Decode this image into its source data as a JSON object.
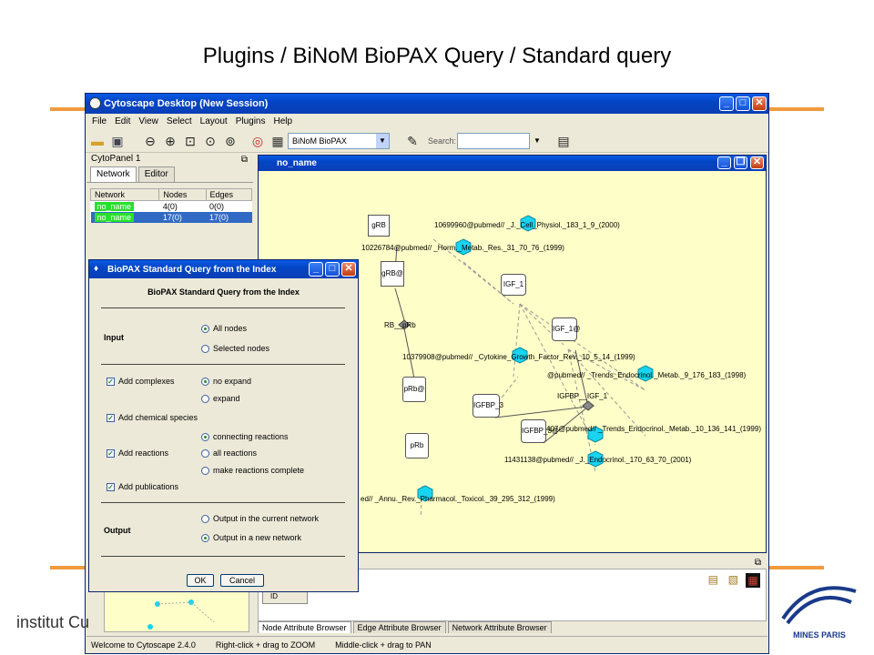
{
  "slide_title": "Plugins / BiNoM BioPAX Query / Standard query",
  "window": {
    "title": "Cytoscape Desktop (New Session)",
    "menu": [
      "File",
      "Edit",
      "View",
      "Select",
      "Layout",
      "Plugins",
      "Help"
    ],
    "plugin_select": "BiNoM BioPAX",
    "search_label": "Search:"
  },
  "cytopanel": {
    "title": "CytoPanel 1",
    "tabs": [
      "Network",
      "Editor"
    ],
    "table": {
      "headers": [
        "Network",
        "Nodes",
        "Edges"
      ],
      "rows": [
        {
          "name": "no_name",
          "nodes": "4(0)",
          "edges": "0(0)"
        },
        {
          "name": "no_name",
          "nodes": "17(0)",
          "edges": "17(0)"
        }
      ]
    }
  },
  "network_view": {
    "title": "no_name",
    "labels": {
      "n1": "10699960@pubmed// _J._Cell_Physiol._183_1_9_(2000)",
      "n2": "10226784@pubmed// _Horm._Metab._Res._31_70_76_(1999)",
      "n3": "10379908@pubmed// _Cytokine_Growth_Factor_Rev._10_5_14_(1999)",
      "n4": "@pubmed// _Trends_Endocrinol._Metab._9_176_183_(1998)",
      "n5": "407@pubmed// _Trends_Endocrinol._Metab._10_136_141_(1999)",
      "n6": "11431138@pubmed// _J._Endocrinol._170_63_70_(2001)",
      "n7": "ed// _Annu._Rev._Pharmacol._Toxicol._39_295_312_(1999)",
      "grb": "gRB",
      "grb_at": "gRB@",
      "rb_prb": "RB__pRb",
      "prb_at": "pRb@",
      "prb": "pRb",
      "igf1": "IGF_1",
      "igf1_at": "IGF_1@",
      "igfbp3": "IGFBP_3",
      "igfbp3_at": "IGFBP_3@",
      "igfbp_igf1": "IGFBP__IGF_1"
    }
  },
  "dialog": {
    "title": "BioPAX Standard Query from the Index",
    "heading": "BioPAX Standard Query from the Index",
    "input_label": "Input",
    "all_nodes": "All nodes",
    "selected_nodes": "Selected nodes",
    "add_complexes": "Add complexes",
    "no_expand": "no expand",
    "expand": "expand",
    "add_chemical": "Add chemical species",
    "connecting_reactions": "connecting reactions",
    "add_reactions": "Add reactions",
    "all_reactions": "all reactions",
    "make_complete": "make reactions complete",
    "add_publications": "Add publications",
    "output_label": "Output",
    "output_current": "Output in the current network",
    "output_new": "Output in a new network",
    "ok": "OK",
    "cancel": "Cancel"
  },
  "bottom": {
    "id_header": "ID",
    "tabs": [
      "Node Attribute Browser",
      "Edge Attribute Browser",
      "Network Attribute Browser"
    ],
    "status": [
      "Welcome to Cytoscape 2.4.0",
      "Right-click + drag to ZOOM",
      "Middle-click + drag to PAN"
    ]
  },
  "logos": {
    "left": "institut Cu",
    "right": "MINES PARIS"
  },
  "colors": {
    "title_blue": "#0345c4",
    "net_bg": "#fefec8",
    "node_cyan": "#19d4f0",
    "slide_accent": "#f19a3e"
  }
}
